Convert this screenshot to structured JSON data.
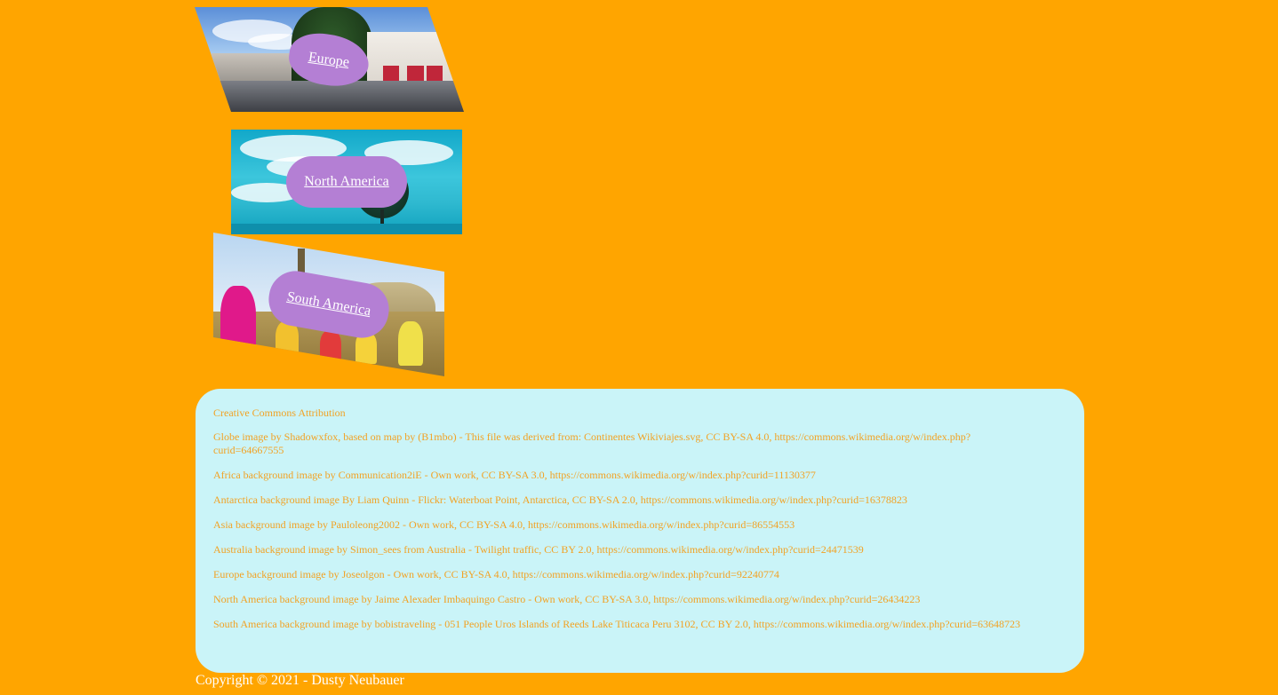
{
  "continents": [
    {
      "label": "Europe"
    },
    {
      "label": "North America"
    },
    {
      "label": "South America"
    }
  ],
  "attribution": {
    "heading": "Creative Commons Attribution",
    "items": [
      "Globe image by Shadowxfox, based on map by (B1mbo) - This file was derived from: Continentes Wikiviajes.svg, CC BY-SA 4.0, https://commons.wikimedia.org/w/index.php?curid=64667555",
      "Africa background image by Communication2iE - Own work, CC BY-SA 3.0, https://commons.wikimedia.org/w/index.php?curid=11130377",
      "Antarctica background image By Liam Quinn - Flickr: Waterboat Point, Antarctica, CC BY-SA 2.0, https://commons.wikimedia.org/w/index.php?curid=16378823",
      "Asia background image by Pauloleong2002 - Own work, CC BY-SA 4.0, https://commons.wikimedia.org/w/index.php?curid=86554553",
      "Australia background image by Simon_sees from Australia - Twilight traffic, CC BY 2.0, https://commons.wikimedia.org/w/index.php?curid=24471539",
      "Europe background image by Joseolgon - Own work, CC BY-SA 4.0, https://commons.wikimedia.org/w/index.php?curid=92240774",
      "North America background image by Jaime Alexader Imbaquingo Castro - Own work, CC BY-SA 3.0, https://commons.wikimedia.org/w/index.php?curid=26434223",
      "South America background image by bobistraveling - 051 People Uros Islands of Reeds Lake Titicaca Peru 3102, CC BY 2.0, https://commons.wikimedia.org/w/index.php?curid=63648723"
    ]
  },
  "footer": {
    "copyright": "Copyright © 2021 - Dusty Neubauer"
  },
  "colors": {
    "page_background": "#ffa500",
    "panel_background": "#caf4f8",
    "pill_background": "#b47fd4",
    "panel_text": "#f2a224"
  }
}
